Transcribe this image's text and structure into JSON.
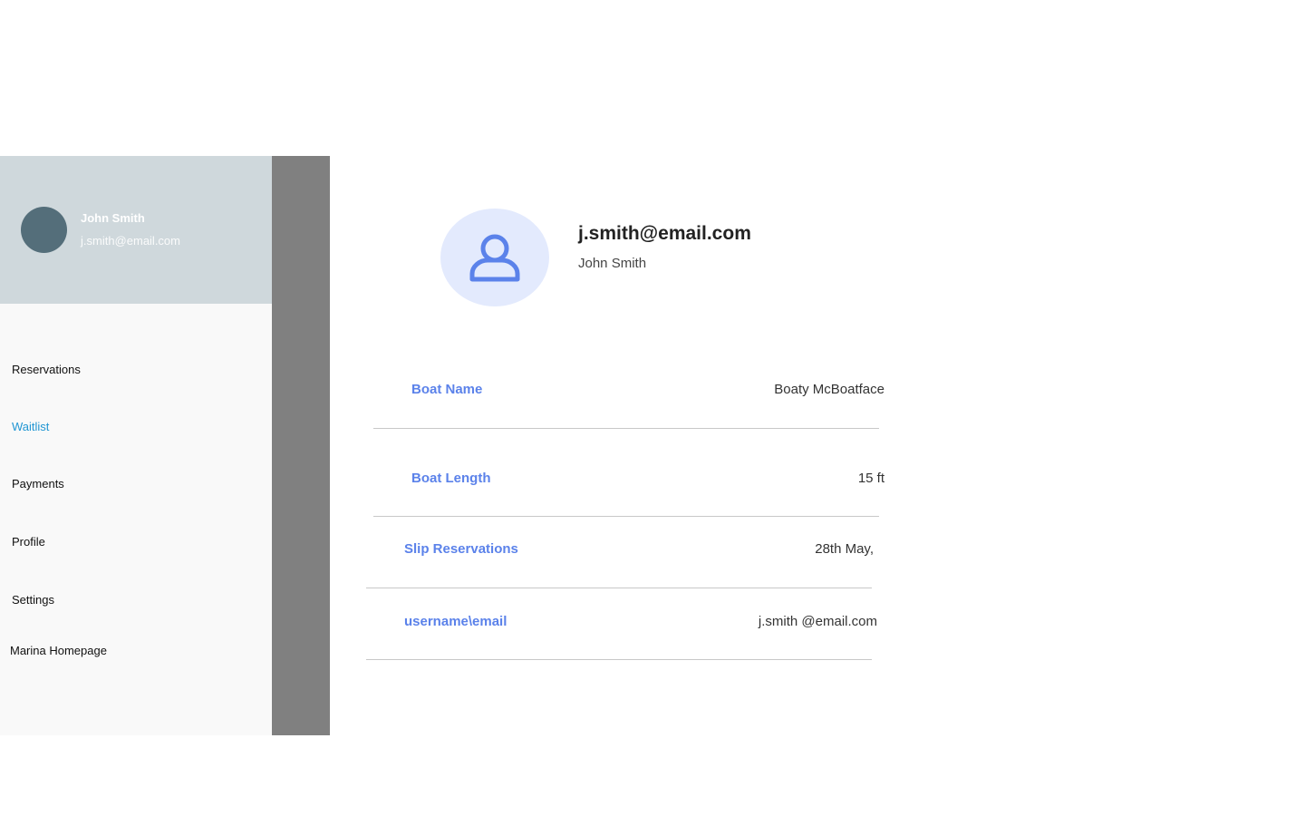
{
  "sidebar": {
    "user_name": "John Smith",
    "user_email": "j.smith@email.com",
    "items": [
      {
        "label": "Reservations",
        "active": false
      },
      {
        "label": "Waitlist",
        "active": true
      },
      {
        "label": "Payments",
        "active": false
      },
      {
        "label": "Profile",
        "active": false
      },
      {
        "label": "Settings",
        "active": false
      },
      {
        "label": "Marina Homepage",
        "active": false
      }
    ],
    "header_color": "#cfd8dc",
    "avatar_color": "#546e7a",
    "active_color": "#2196d3"
  },
  "profile": {
    "email": "j.smith@email.com",
    "name": "John Smith",
    "avatar_icon": "user-icon"
  },
  "details": [
    {
      "label": "Boat Name",
      "value": "Boaty McBoatface"
    },
    {
      "label": "Boat Length",
      "value": "15 ft"
    },
    {
      "label": "Slip Reservations",
      "value": "28th May,"
    },
    {
      "label": "username\\email",
      "value": "j.smith @email.com"
    }
  ],
  "colors": {
    "label": "#5b82ea",
    "scrim": "#808080"
  }
}
